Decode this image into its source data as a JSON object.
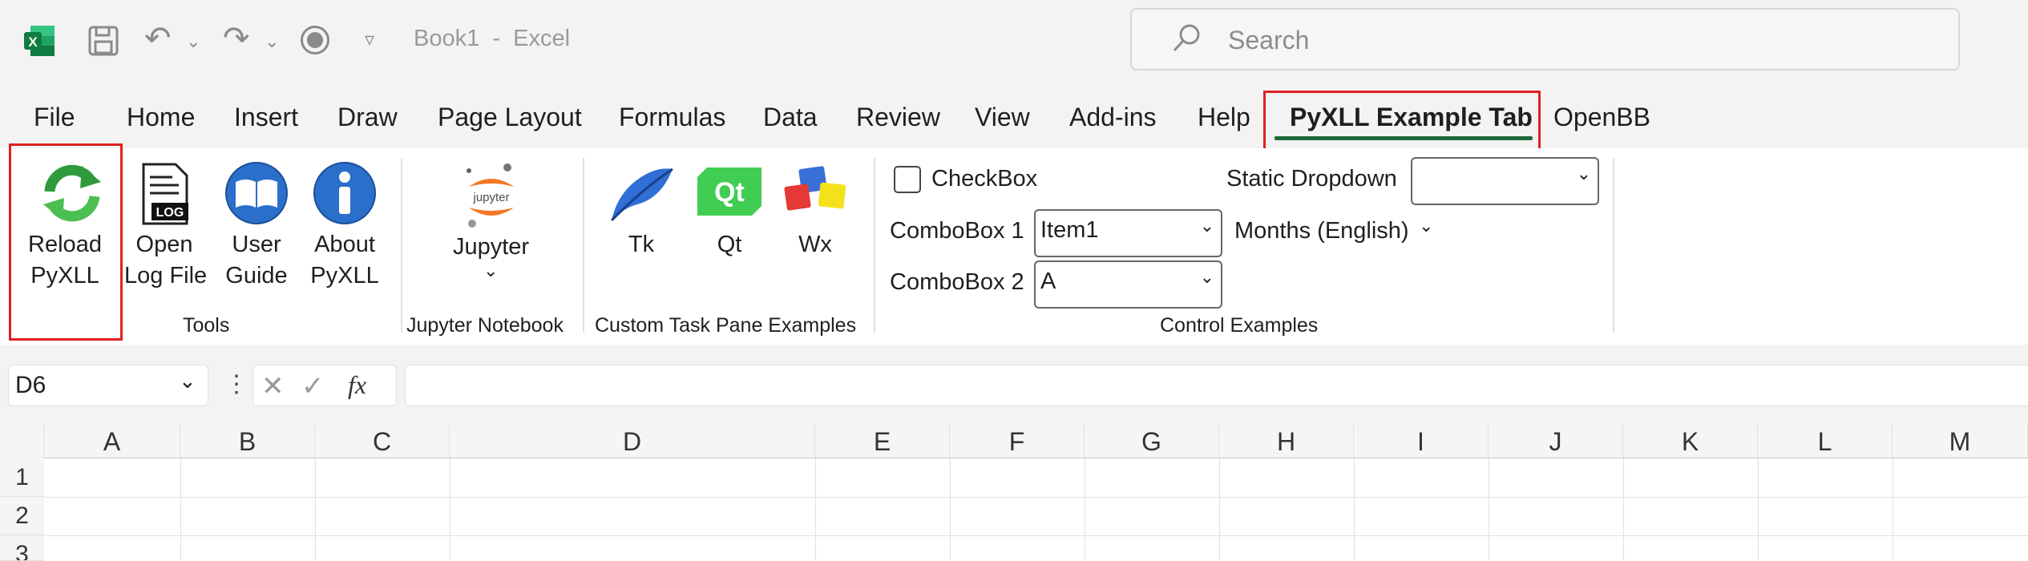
{
  "titlebar": {
    "doc_title": "Book1  -  Excel",
    "search_placeholder": "Search"
  },
  "tabs": [
    "File",
    "Home",
    "Insert",
    "Draw",
    "Page Layout",
    "Formulas",
    "Data",
    "Review",
    "View",
    "Add-ins",
    "Help",
    "PyXLL Example Tab",
    "OpenBB"
  ],
  "ribbon": {
    "tools": {
      "reload": [
        "Reload",
        "PyXLL"
      ],
      "openlog": [
        "Open",
        "Log File"
      ],
      "guide": [
        "User",
        "Guide"
      ],
      "about": [
        "About",
        "PyXLL"
      ],
      "group": "Tools",
      "log_badge": "LOG"
    },
    "jupyter": {
      "label": "Jupyter",
      "logo_text": "jupyter",
      "group": "Jupyter Notebook"
    },
    "ctp": {
      "tk": "Tk",
      "qt": "Qt",
      "qt_logo": "Qt",
      "wx": "Wx",
      "group": "Custom Task Pane Examples"
    },
    "controls": {
      "checkbox": "CheckBox",
      "static_dropdown": "Static Dropdown",
      "combo1_label": "ComboBox 1",
      "combo1_value": "Item1",
      "combo2_label": "ComboBox 2",
      "combo2_value": "A",
      "months": "Months (English)",
      "group": "Control Examples"
    }
  },
  "formula_bar": {
    "name_box": "D6",
    "fx": "fx",
    "value": ""
  },
  "grid": {
    "columns": [
      "A",
      "B",
      "C",
      "D",
      "E",
      "F",
      "G",
      "H",
      "I",
      "J",
      "K",
      "L",
      "M"
    ],
    "rows": [
      "1",
      "2",
      "3"
    ]
  },
  "colors": {
    "accent": "#1e6b3a",
    "highlight": "#e02020"
  }
}
